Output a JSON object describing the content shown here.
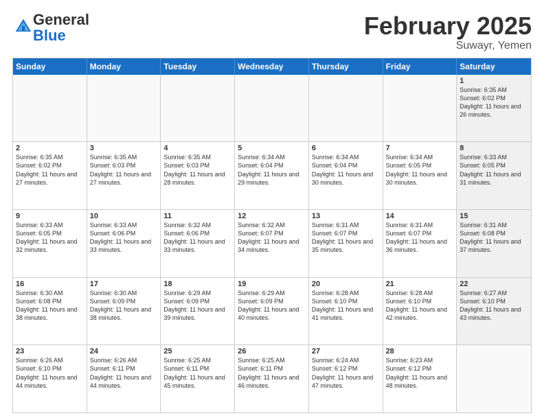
{
  "header": {
    "logo": {
      "general": "General",
      "blue": "Blue"
    },
    "title": "February 2025",
    "subtitle": "Suwayr, Yemen"
  },
  "days_of_week": [
    "Sunday",
    "Monday",
    "Tuesday",
    "Wednesday",
    "Thursday",
    "Friday",
    "Saturday"
  ],
  "weeks": [
    [
      {
        "day": "",
        "info": "",
        "empty": true
      },
      {
        "day": "",
        "info": "",
        "empty": true
      },
      {
        "day": "",
        "info": "",
        "empty": true
      },
      {
        "day": "",
        "info": "",
        "empty": true
      },
      {
        "day": "",
        "info": "",
        "empty": true
      },
      {
        "day": "",
        "info": "",
        "empty": true
      },
      {
        "day": "1",
        "info": "Sunrise: 6:35 AM\nSunset: 6:02 PM\nDaylight: 11 hours and 26 minutes.",
        "shaded": true
      }
    ],
    [
      {
        "day": "2",
        "info": "Sunrise: 6:35 AM\nSunset: 6:02 PM\nDaylight: 11 hours and 27 minutes.",
        "shaded": false
      },
      {
        "day": "3",
        "info": "Sunrise: 6:35 AM\nSunset: 6:03 PM\nDaylight: 11 hours and 27 minutes.",
        "shaded": false
      },
      {
        "day": "4",
        "info": "Sunrise: 6:35 AM\nSunset: 6:03 PM\nDaylight: 11 hours and 28 minutes.",
        "shaded": false
      },
      {
        "day": "5",
        "info": "Sunrise: 6:34 AM\nSunset: 6:04 PM\nDaylight: 11 hours and 29 minutes.",
        "shaded": false
      },
      {
        "day": "6",
        "info": "Sunrise: 6:34 AM\nSunset: 6:04 PM\nDaylight: 11 hours and 30 minutes.",
        "shaded": false
      },
      {
        "day": "7",
        "info": "Sunrise: 6:34 AM\nSunset: 6:05 PM\nDaylight: 11 hours and 30 minutes.",
        "shaded": false
      },
      {
        "day": "8",
        "info": "Sunrise: 6:33 AM\nSunset: 6:05 PM\nDaylight: 11 hours and 31 minutes.",
        "shaded": true
      }
    ],
    [
      {
        "day": "9",
        "info": "Sunrise: 6:33 AM\nSunset: 6:05 PM\nDaylight: 11 hours and 32 minutes.",
        "shaded": false
      },
      {
        "day": "10",
        "info": "Sunrise: 6:33 AM\nSunset: 6:06 PM\nDaylight: 11 hours and 33 minutes.",
        "shaded": false
      },
      {
        "day": "11",
        "info": "Sunrise: 6:32 AM\nSunset: 6:06 PM\nDaylight: 11 hours and 33 minutes.",
        "shaded": false
      },
      {
        "day": "12",
        "info": "Sunrise: 6:32 AM\nSunset: 6:07 PM\nDaylight: 11 hours and 34 minutes.",
        "shaded": false
      },
      {
        "day": "13",
        "info": "Sunrise: 6:31 AM\nSunset: 6:07 PM\nDaylight: 11 hours and 35 minutes.",
        "shaded": false
      },
      {
        "day": "14",
        "info": "Sunrise: 6:31 AM\nSunset: 6:07 PM\nDaylight: 11 hours and 36 minutes.",
        "shaded": false
      },
      {
        "day": "15",
        "info": "Sunrise: 6:31 AM\nSunset: 6:08 PM\nDaylight: 11 hours and 37 minutes.",
        "shaded": true
      }
    ],
    [
      {
        "day": "16",
        "info": "Sunrise: 6:30 AM\nSunset: 6:08 PM\nDaylight: 11 hours and 38 minutes.",
        "shaded": false
      },
      {
        "day": "17",
        "info": "Sunrise: 6:30 AM\nSunset: 6:09 PM\nDaylight: 11 hours and 38 minutes.",
        "shaded": false
      },
      {
        "day": "18",
        "info": "Sunrise: 6:29 AM\nSunset: 6:09 PM\nDaylight: 11 hours and 39 minutes.",
        "shaded": false
      },
      {
        "day": "19",
        "info": "Sunrise: 6:29 AM\nSunset: 6:09 PM\nDaylight: 11 hours and 40 minutes.",
        "shaded": false
      },
      {
        "day": "20",
        "info": "Sunrise: 6:28 AM\nSunset: 6:10 PM\nDaylight: 11 hours and 41 minutes.",
        "shaded": false
      },
      {
        "day": "21",
        "info": "Sunrise: 6:28 AM\nSunset: 6:10 PM\nDaylight: 11 hours and 42 minutes.",
        "shaded": false
      },
      {
        "day": "22",
        "info": "Sunrise: 6:27 AM\nSunset: 6:10 PM\nDaylight: 11 hours and 43 minutes.",
        "shaded": true
      }
    ],
    [
      {
        "day": "23",
        "info": "Sunrise: 6:26 AM\nSunset: 6:10 PM\nDaylight: 11 hours and 44 minutes.",
        "shaded": false
      },
      {
        "day": "24",
        "info": "Sunrise: 6:26 AM\nSunset: 6:11 PM\nDaylight: 11 hours and 44 minutes.",
        "shaded": false
      },
      {
        "day": "25",
        "info": "Sunrise: 6:25 AM\nSunset: 6:11 PM\nDaylight: 11 hours and 45 minutes.",
        "shaded": false
      },
      {
        "day": "26",
        "info": "Sunrise: 6:25 AM\nSunset: 6:11 PM\nDaylight: 11 hours and 46 minutes.",
        "shaded": false
      },
      {
        "day": "27",
        "info": "Sunrise: 6:24 AM\nSunset: 6:12 PM\nDaylight: 11 hours and 47 minutes.",
        "shaded": false
      },
      {
        "day": "28",
        "info": "Sunrise: 6:23 AM\nSunset: 6:12 PM\nDaylight: 11 hours and 48 minutes.",
        "shaded": false
      },
      {
        "day": "",
        "info": "",
        "empty": true
      }
    ]
  ]
}
